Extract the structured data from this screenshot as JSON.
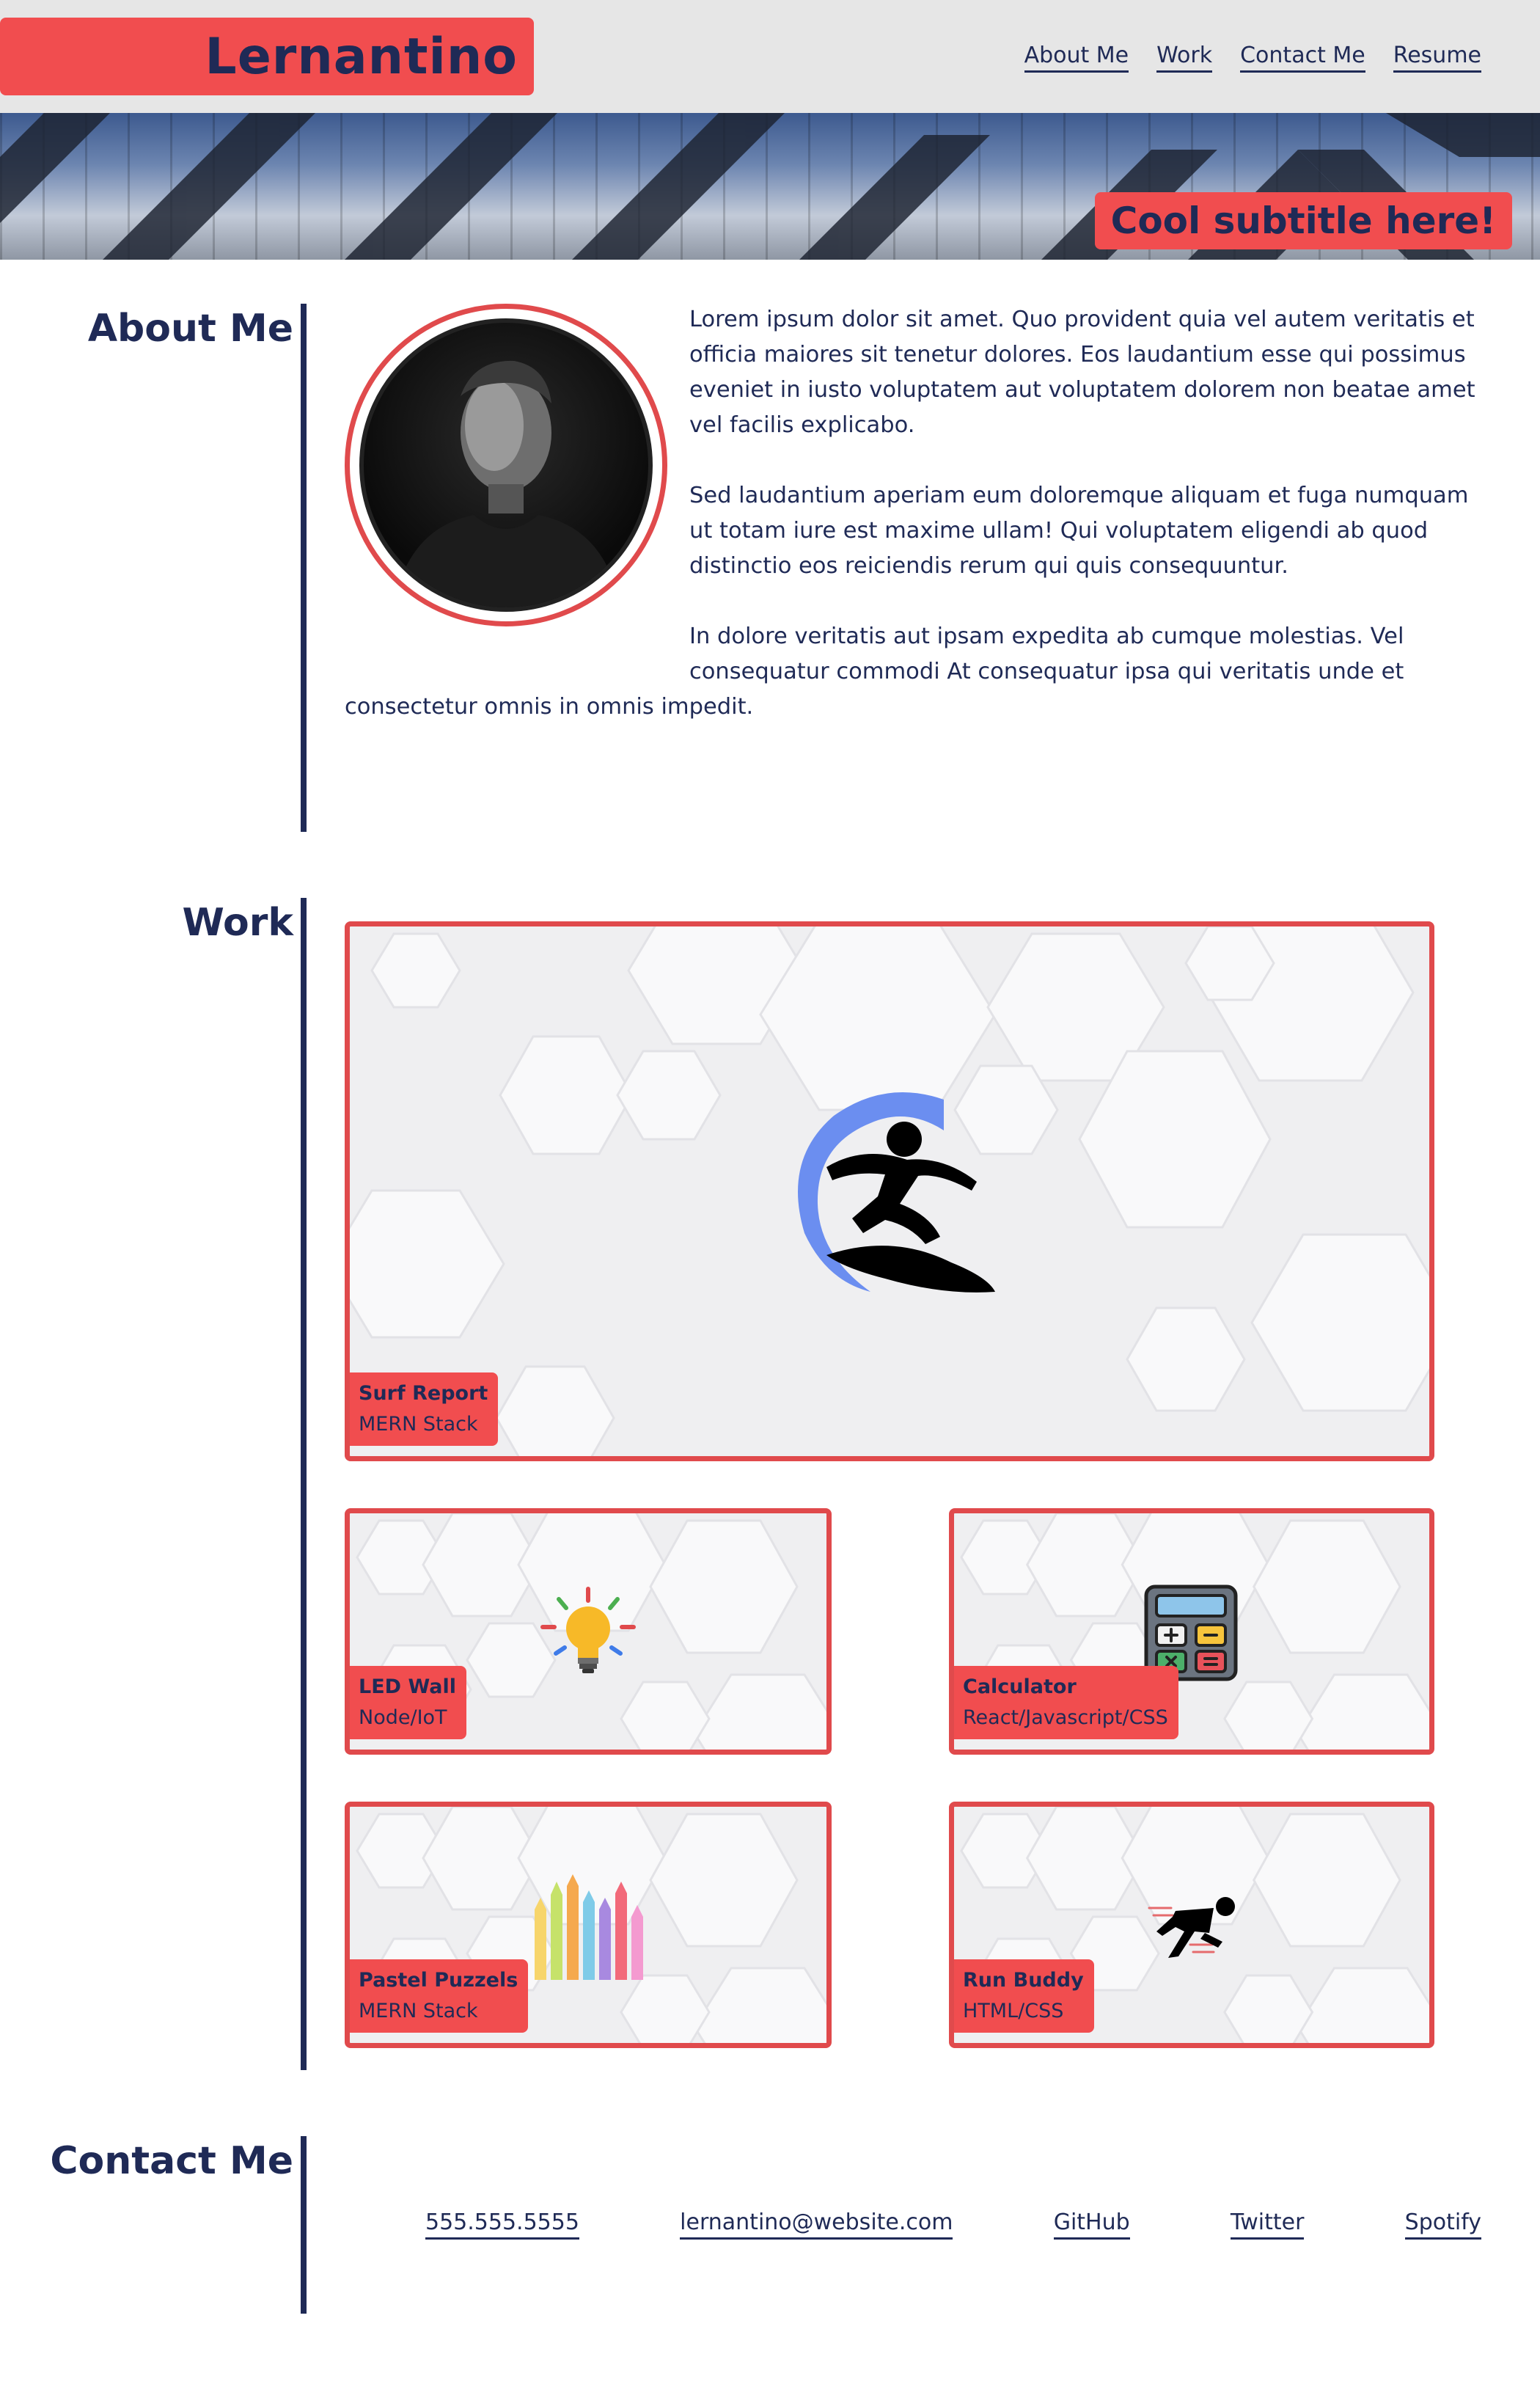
{
  "header": {
    "brand": "Lernantino",
    "nav": [
      {
        "label": "About Me"
      },
      {
        "label": "Work"
      },
      {
        "label": "Contact Me"
      },
      {
        "label": "Resume"
      }
    ]
  },
  "hero": {
    "subtitle": "Cool subtitle here!"
  },
  "about": {
    "title": "About Me",
    "paragraphs": [
      "Lorem ipsum dolor sit amet. Quo provident quia vel autem veritatis et officia maiores sit tenetur dolores. Eos laudantium esse qui possimus eveniet in iusto voluptatem aut voluptatem dolorem non beatae amet vel facilis explicabo.",
      "Sed laudantium aperiam eum doloremque aliquam et fuga numquam ut totam iure est maxime ullam! Qui voluptatem eligendi ab quod distinctio eos reiciendis rerum qui quis consequuntur.",
      "In dolore veritatis aut ipsam expedita ab cumque molestias. Vel consequatur commodi At consequatur ipsa qui veritatis unde et consectetur omnis in omnis impedit."
    ]
  },
  "work": {
    "title": "Work",
    "projects": [
      {
        "title": "Surf Report",
        "stack": "MERN Stack",
        "icon": "surfer-icon"
      },
      {
        "title": "LED Wall",
        "stack": "Node/IoT",
        "icon": "lightbulb-icon"
      },
      {
        "title": "Calculator",
        "stack": "React/Javascript/CSS",
        "icon": "calculator-icon"
      },
      {
        "title": "Pastel Puzzels",
        "stack": "MERN Stack",
        "icon": "pencils-icon"
      },
      {
        "title": "Run Buddy",
        "stack": "HTML/CSS",
        "icon": "runner-icon"
      }
    ]
  },
  "contact": {
    "title": "Contact Me",
    "links": [
      {
        "label": "555.555.5555"
      },
      {
        "label": "lernantino@website.com"
      },
      {
        "label": "GitHub"
      },
      {
        "label": "Twitter"
      },
      {
        "label": "Spotify"
      }
    ]
  },
  "colors": {
    "accent": "#f14d4f",
    "navy": "#1f2a56",
    "header_bg": "#e6e6e6"
  }
}
